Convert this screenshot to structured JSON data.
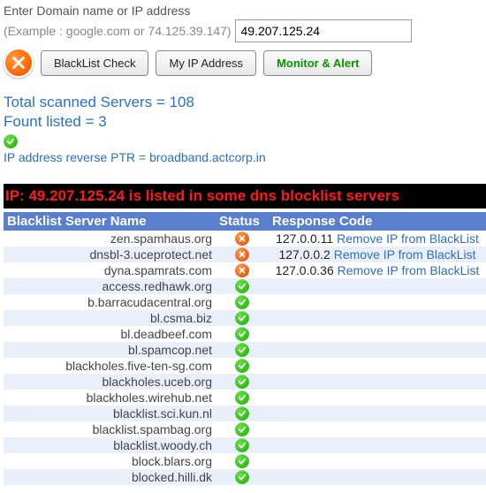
{
  "form": {
    "label": "Enter Domain name or IP address",
    "example": "(Example : google.com or 74.125.39.147)",
    "value": "49.207.125.24"
  },
  "buttons": {
    "blacklist_check": "BlackList Check",
    "my_ip": "My IP Address",
    "monitor_alert": "Monitor & Alert"
  },
  "summary": {
    "scanned_label": "Total scanned Servers = ",
    "scanned_value": "108",
    "found_label": "Fount listed = ",
    "found_value": "3",
    "ptr_label": "IP address reverse PTR = ",
    "ptr_value": "broadband.actcorp.in"
  },
  "warning": "IP: 49.207.125.24 is listed in some dns blocklist servers",
  "table": {
    "headers": {
      "server": "Blacklist Server Name",
      "status": "Status",
      "resp": "Response Code"
    },
    "remove_text": "Remove IP from BlackList",
    "rows": [
      {
        "server": "zen.spamhaus.org",
        "status": "bad",
        "resp": "127.0.0.11",
        "action": true
      },
      {
        "server": "dnsbl-3.uceprotect.net",
        "status": "bad",
        "resp": "127.0.0.2",
        "action": true
      },
      {
        "server": "dyna.spamrats.com",
        "status": "bad",
        "resp": "127.0.0.36",
        "action": true
      },
      {
        "server": "access.redhawk.org",
        "status": "ok"
      },
      {
        "server": "b.barracudacentral.org",
        "status": "ok"
      },
      {
        "server": "bl.csma.biz",
        "status": "ok"
      },
      {
        "server": "bl.deadbeef.com",
        "status": "ok"
      },
      {
        "server": "bl.spamcop.net",
        "status": "ok"
      },
      {
        "server": "blackholes.five-ten-sg.com",
        "status": "ok"
      },
      {
        "server": "blackholes.uceb.org",
        "status": "ok"
      },
      {
        "server": "blackholes.wirehub.net",
        "status": "ok"
      },
      {
        "server": "blacklist.sci.kun.nl",
        "status": "ok"
      },
      {
        "server": "blacklist.spambag.org",
        "status": "ok"
      },
      {
        "server": "blacklist.woody.ch",
        "status": "ok"
      },
      {
        "server": "block.blars.org",
        "status": "ok"
      },
      {
        "server": "blocked.hilli.dk",
        "status": "ok"
      }
    ]
  }
}
